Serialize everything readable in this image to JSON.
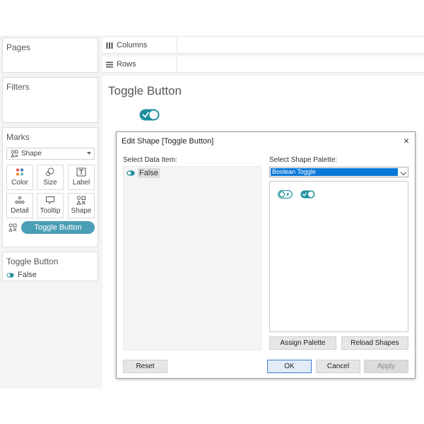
{
  "left_panel": {
    "pages_title": "Pages",
    "filters_title": "Filters",
    "marks_title": "Marks",
    "mark_type": "Shape",
    "mark_buttons": [
      {
        "label": "Color",
        "icon": "color-dots-icon"
      },
      {
        "label": "Size",
        "icon": "size-icon"
      },
      {
        "label": "Label",
        "icon": "label-icon"
      },
      {
        "label": "Detail",
        "icon": "detail-icon"
      },
      {
        "label": "Tooltip",
        "icon": "tooltip-icon"
      },
      {
        "label": "Shape",
        "icon": "shape-icon"
      }
    ],
    "shape_pill": "Toggle Button",
    "legend_title": "Toggle Button",
    "legend_item": "False"
  },
  "shelves": {
    "columns_label": "Columns",
    "rows_label": "Rows"
  },
  "sheet": {
    "title": "Toggle Button"
  },
  "dialog": {
    "title": "Edit Shape [Toggle Button]",
    "close": "×",
    "select_data_label": "Select Data Item:",
    "data_items": [
      "False"
    ],
    "select_palette_label": "Select Shape Palette:",
    "palette_value": "Boolean Toggle",
    "buttons": {
      "assign": "Assign Palette",
      "reload": "Reload Shapes",
      "reset": "Reset",
      "ok": "OK",
      "cancel": "Cancel",
      "apply": "Apply"
    }
  },
  "colors": {
    "accent": "#4a9eb5",
    "toggle_teal": "#1f8f9c",
    "selection_blue": "#0a78d8"
  }
}
